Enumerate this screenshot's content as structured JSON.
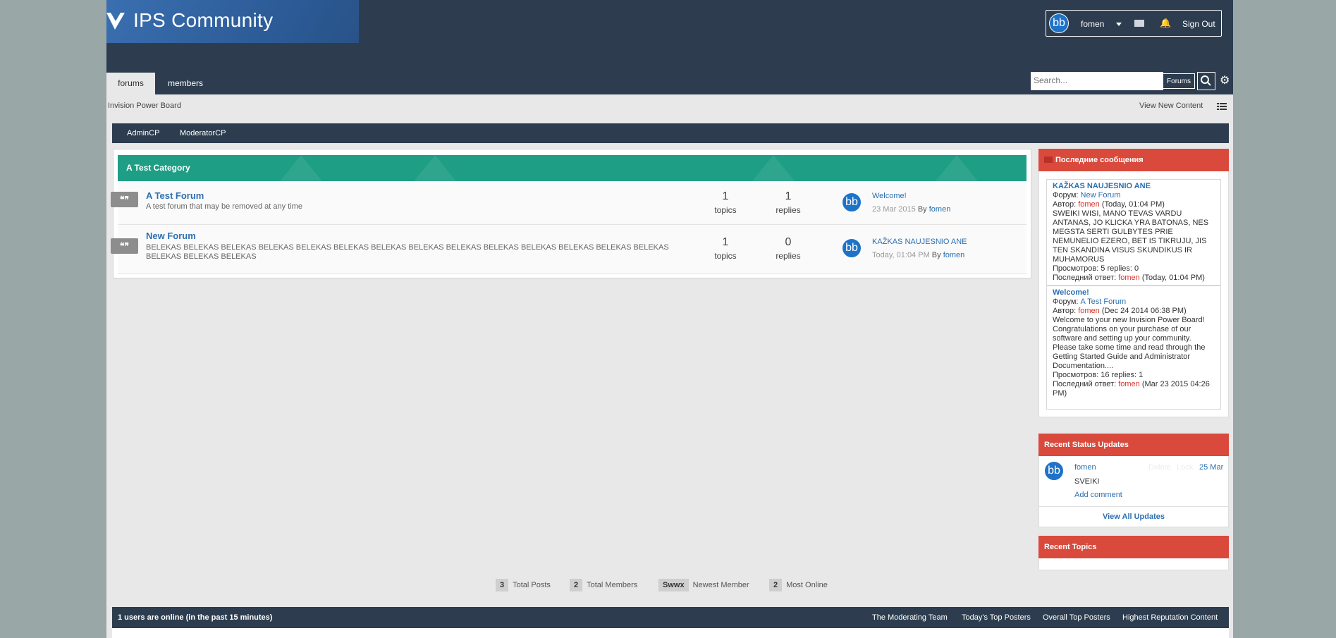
{
  "header": {
    "logo_text": "IPS Community",
    "user": {
      "avatar_text": "bb",
      "name": "fomen",
      "sign_out": "Sign Out"
    },
    "tabs": [
      {
        "label": "forums"
      },
      {
        "label": "members"
      }
    ],
    "search": {
      "placeholder": "Search...",
      "scope": "Forums"
    }
  },
  "breadcrumb": "Invision Power Board",
  "view_new_content": "View New Content",
  "modbar": {
    "admin": "AdminCP",
    "moderator": "ModeratorCP"
  },
  "category": {
    "title": "A Test Category",
    "forums": [
      {
        "title": "A Test Forum",
        "description": "A test forum that may be removed at any time",
        "topics": "1",
        "topics_label": "topics",
        "replies": "1",
        "replies_label": "replies",
        "avatar_text": "bb",
        "last_post_title": "Welcome!",
        "last_post_date": "23 Mar 2015",
        "last_post_by_label": "By",
        "last_post_author": "fomen"
      },
      {
        "title": "New Forum",
        "description": "BELEKAS BELEKAS BELEKAS BELEKAS BELEKAS BELEKAS BELEKAS BELEKAS BELEKAS BELEKAS BELEKAS BELEKAS BELEKAS BELEKAS BELEKAS BELEKAS BELEKAS",
        "topics": "1",
        "topics_label": "topics",
        "replies": "0",
        "replies_label": "replies",
        "avatar_text": "bb",
        "last_post_title": "KAŽKAS NAUJESNIO ANE",
        "last_post_date": "Today, 01:04 PM",
        "last_post_by_label": "By",
        "last_post_author": "fomen"
      }
    ]
  },
  "sidebar": {
    "latest_posts": {
      "title": "Последние сообщения",
      "items": [
        {
          "title": "KAŽKAS NAUJESNIO ANE",
          "forum_label": "Форум:",
          "forum": "New Forum",
          "author_label": "Автор:",
          "author": "fomen",
          "author_date": "(Today, 01:04 PM)",
          "body": "SWEIKI WISI, MANO TEVAS VARDU ANTANAS, JO KLICKA YRA BATONAS, NES MEGSTA SERTI GULBYTES PRIE NEMUNELIO EZERO, BET IS TIKRUJU, JIS TEN SKANDINA VISUS SKUNDIKUS IR MUHAMORUS",
          "views": "Просмотров: 5    replies: 0",
          "last_reply_label": "Последний ответ:",
          "last_reply_author": "fomen",
          "last_reply_date": "(Today, 01:04 PM)"
        },
        {
          "title": "Welcome!",
          "forum_label": "Форум:",
          "forum": "A Test Forum",
          "author_label": "Автор:",
          "author": "fomen",
          "author_date": "(Dec 24 2014 06:38 PM)",
          "body": "Welcome to your new Invision Power Board! Congratulations on your purchase of our software and setting up your community. Please take some time and read through the Getting Started Guide and Administrator Documentation....",
          "views": "Просмотров: 16    replies: 1",
          "last_reply_label": "Последний ответ:",
          "last_reply_author": "fomen",
          "last_reply_date": "(Mar 23 2015 04:26 PM)"
        }
      ]
    },
    "status_updates": {
      "title": "Recent Status Updates",
      "avatar_text": "bb",
      "author": "fomen",
      "delete": "Delete",
      "lock": "Lock",
      "date": "25 Mar",
      "text": "SVEIKI",
      "add_comment": "Add comment",
      "view_all": "View All Updates"
    },
    "recent_topics": {
      "title": "Recent Topics"
    }
  },
  "stats": [
    {
      "value": "3",
      "label": "Total Posts"
    },
    {
      "value": "2",
      "label": "Total Members"
    },
    {
      "value": "Swwx",
      "label": "Newest Member"
    },
    {
      "value": "2",
      "label": "Most Online"
    }
  ],
  "footer": {
    "online": "1 users are online (in the past 15 minutes)",
    "links": [
      "The Moderating Team",
      "Today's Top Posters",
      "Overall Top Posters",
      "Highest Reputation Content"
    ]
  },
  "colors": {
    "header": "#2d3d4f",
    "category": "#1e9e85",
    "sidebar_head": "#d9493c",
    "link": "#2c6fb0",
    "logo_blue": "#3a6fb0"
  },
  "icons": [
    "logo-icon",
    "caret-down-icon",
    "mail-icon",
    "bell-icon",
    "search-icon",
    "gear-icon",
    "list-view-icon",
    "quote-icon",
    "rss-icon"
  ]
}
